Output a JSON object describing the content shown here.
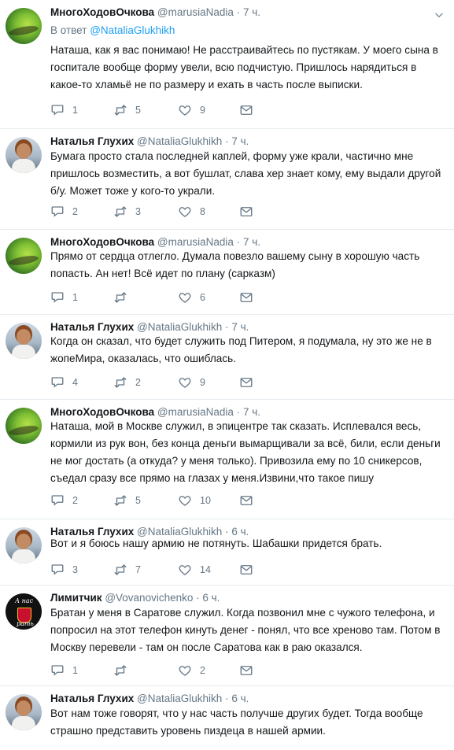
{
  "tweets": [
    {
      "name": "МногоХодовОчкова",
      "handle": "@marusiaNadia",
      "dot": "·",
      "time": "7 ч.",
      "avatar": "green-eye-avatar",
      "reply_prefix": "В ответ",
      "reply_to": "@NataliaGlukhikh",
      "text": "Наташа, как я вас понимаю! Не расстраивайтесь по пустякам. У моего сына в госпитале вообще форму увели, всю подчистую. Пришлось нарядиться в какое-то хламьё не по размеру и ехать в часть после выписки.",
      "replies": "1",
      "retweets": "5",
      "likes": "9"
    },
    {
      "name": "Наталья Глухих",
      "handle": "@NataliaGlukhikh",
      "dot": "·",
      "time": "7 ч.",
      "avatar": "photo-avatar",
      "text": "Бумага просто стала последней каплей, форму уже крали, частично мне пришлось возместить, а вот бушлат, слава хер знает кому, ему выдали другой б/у. Может тоже у кого-то украли.",
      "replies": "2",
      "retweets": "3",
      "likes": "8"
    },
    {
      "name": "МногоХодовОчкова",
      "handle": "@marusiaNadia",
      "dot": "·",
      "time": "7 ч.",
      "avatar": "green-eye-avatar",
      "text": "Прямо от сердца отлегло. Думала повезло вашему сыну в хорошую часть попасть. Ан нет! Всё идет по плану (сарказм)",
      "replies": "1",
      "retweets": "",
      "likes": "6"
    },
    {
      "name": "Наталья Глухих",
      "handle": "@NataliaGlukhikh",
      "dot": "·",
      "time": "7 ч.",
      "avatar": "photo-avatar",
      "text": "Когда он сказал, что будет служить под Питером, я подумала, ну это же не в жопеМира, оказалась, что ошиблась.",
      "replies": "4",
      "retweets": "2",
      "likes": "9"
    },
    {
      "name": "МногоХодовОчкова",
      "handle": "@marusiaNadia",
      "dot": "·",
      "time": "7 ч.",
      "avatar": "green-eye-avatar",
      "text": "Наташа, мой в Москве служил, в эпицентре так сказать. Исплевался весь, кормили из рук вон, без конца деньги вымарщивали за всё, били, если деньги не мог достать (а откуда? у меня только). Привозила ему по 10 сникерсов, съедал сразу все прямо на глазах у меня.Извини,что такое пишу",
      "replies": "2",
      "retweets": "5",
      "likes": "10"
    },
    {
      "name": "Наталья Глухих",
      "handle": "@NataliaGlukhikh",
      "dot": "·",
      "time": "6 ч.",
      "avatar": "photo-avatar",
      "text": "Вот и я боюсь нашу армию не потянуть. Шабашки придется брать.",
      "replies": "3",
      "retweets": "7",
      "likes": "14"
    },
    {
      "name": "Лимитчик",
      "handle": "@Vovanovichenko",
      "dot": "·",
      "time": "6 ч.",
      "avatar": "black-crest-avatar",
      "avatar_text_top": "А нас",
      "avatar_text_bottom": "рать",
      "text": "Братан у меня в Саратове служил. Когда позвонил мне с чужого телефона, и попросил на этот телефон кинуть денег - понял, что все хреново там. Потом в Москву перевели - там он после Саратова как в раю оказался.",
      "replies": "1",
      "retweets": "",
      "likes": "2"
    },
    {
      "name": "Наталья Глухих",
      "handle": "@NataliaGlukhikh",
      "dot": "·",
      "time": "6 ч.",
      "avatar": "photo-avatar",
      "text": "Вот нам тоже говорят, что у нас часть получше других будет. Тогда вообще страшно представить уровень пиздеца в нашей армии.",
      "replies": "",
      "retweets": "",
      "likes": ""
    }
  ],
  "icons": {
    "reply": "reply-icon",
    "retweet": "retweet-icon",
    "like": "heart-icon",
    "dm": "envelope-icon",
    "more": "chevron-down-icon"
  },
  "colors": {
    "link": "#1da1f2",
    "muted": "#657786",
    "text": "#14171a",
    "separator": "#e6ecf0"
  }
}
